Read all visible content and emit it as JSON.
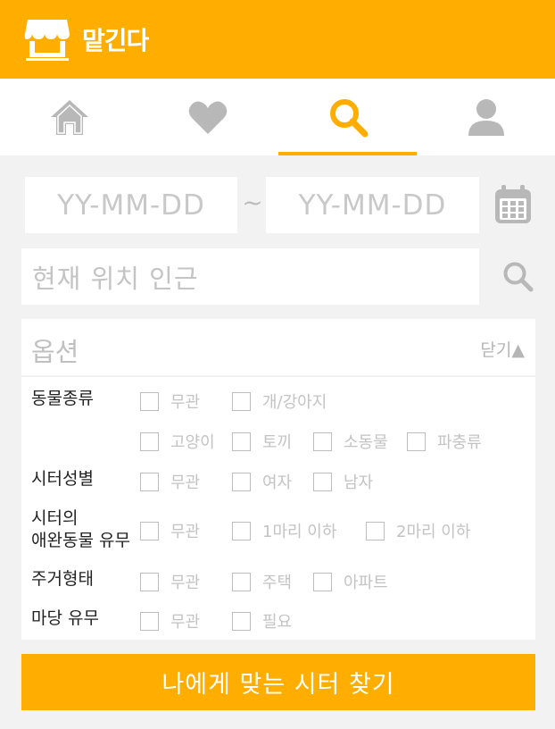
{
  "header": {
    "title": "맡긴다",
    "logo_icon": "storefront-icon"
  },
  "tabs": [
    {
      "name": "home",
      "icon": "home-icon",
      "active": false
    },
    {
      "name": "favorites",
      "icon": "heart-icon",
      "active": false
    },
    {
      "name": "search",
      "icon": "search-icon",
      "active": true
    },
    {
      "name": "profile",
      "icon": "user-icon",
      "active": false
    }
  ],
  "search": {
    "start_date_placeholder": "YY-MM-DD",
    "tilde": "~",
    "end_date_placeholder": "YY-MM-DD",
    "location_placeholder": "현재 위치 인근"
  },
  "options": {
    "label": "옵션",
    "close_label": "닫기▲",
    "rows": {
      "animal_type": {
        "label": "동물종류",
        "choices": [
          "무관",
          "개/강아지",
          "고양이",
          "토끼",
          "소동물",
          "파충류"
        ]
      },
      "sitter_gender": {
        "label": "시터성별",
        "choices": [
          "무관",
          "여자",
          "남자"
        ]
      },
      "sitter_pet": {
        "label_line1": "시터의",
        "label_line2": "애완동물 유무",
        "choices": [
          "무관",
          "1마리 이하",
          "2마리 이하"
        ]
      },
      "housing": {
        "label": "주거형태",
        "choices": [
          "무관",
          "주택",
          "아파트"
        ]
      },
      "yard": {
        "label": "마당 유무",
        "choices": [
          "무관",
          "필요"
        ]
      }
    }
  },
  "submit_label": "나에게 맞는 시터 찾기",
  "colors": {
    "accent": "#ffae00",
    "icon_gray": "#b8b8b8",
    "background": "#f2f2f2"
  }
}
